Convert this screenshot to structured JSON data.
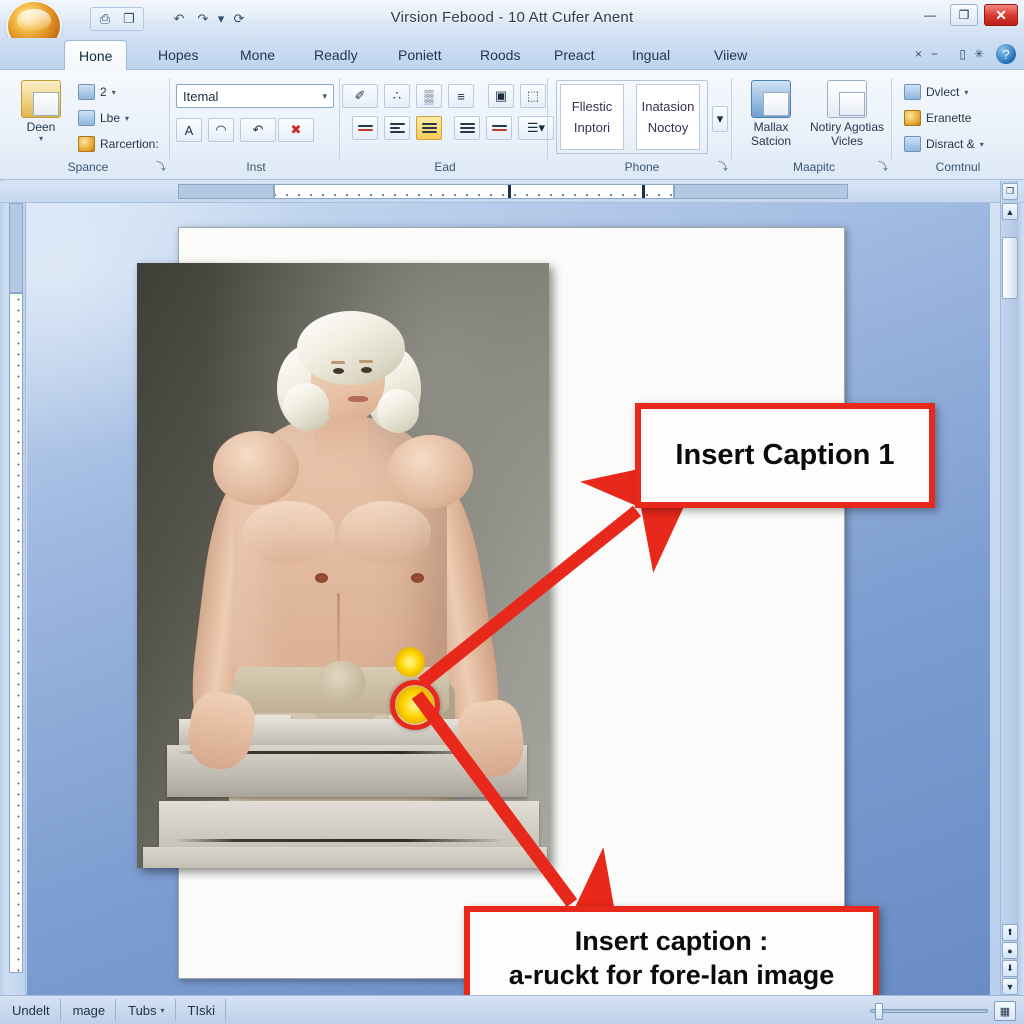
{
  "window": {
    "title": "Virsion Febood - 10 Att Cufer Anent",
    "minimize_label": "—",
    "restore_label": "❐",
    "close_label": "✕"
  },
  "quick_access": {
    "items": [
      {
        "name": "save-icon",
        "glyph": "⎙"
      },
      {
        "name": "new-document-icon",
        "glyph": "❐"
      },
      {
        "name": "undo-icon",
        "glyph": "↶"
      },
      {
        "name": "redo-icon",
        "glyph": "↷"
      },
      {
        "name": "customize-icon",
        "glyph": "▾"
      },
      {
        "name": "print-preview-icon",
        "glyph": "⟳"
      }
    ]
  },
  "tabs": [
    {
      "label": "Hone",
      "active": true
    },
    {
      "label": "Hopes",
      "active": false
    },
    {
      "label": "Mone",
      "active": false
    },
    {
      "label": "Readly",
      "active": false
    },
    {
      "label": "Poniett",
      "active": false
    },
    {
      "label": "Roods",
      "active": false
    },
    {
      "label": "Preact",
      "active": false
    },
    {
      "label": "Ingual",
      "active": false
    },
    {
      "label": "Viiew",
      "active": false
    }
  ],
  "ribbon_controls": {
    "close_label": "×",
    "minimize_label": "−",
    "doc_label": "▯",
    "star_label": "✳",
    "help_label": "?"
  },
  "ribbon": {
    "groups": [
      {
        "name": "Spance",
        "big_button": "Deen",
        "small_items": [
          {
            "label": "2",
            "icon": "paste-icon",
            "caret": true
          },
          {
            "label": "Lbe",
            "icon": "copy-icon",
            "caret": true
          },
          {
            "label": "Rarcertion:",
            "icon": "format-painter-icon",
            "caret": false
          }
        ],
        "dialog_launcher": "⤵"
      },
      {
        "name": "Inst",
        "font_value": "Itemal",
        "buttons_top": [
          {
            "name": "text-effects-icon",
            "glyph": "∴"
          },
          {
            "name": "shading-icon",
            "glyph": "▒"
          },
          {
            "name": "align-icon",
            "glyph": "≡"
          }
        ],
        "buttons_bottom": [
          {
            "name": "bold-icon",
            "glyph": "A"
          },
          {
            "name": "highlight-icon",
            "glyph": "◠"
          },
          {
            "name": "undo-format-icon",
            "glyph": "↶"
          },
          {
            "name": "clear-format-icon",
            "glyph": "✖",
            "caret": true
          },
          {
            "name": "font-color-icon",
            "glyph": "✐",
            "caret": true
          }
        ]
      },
      {
        "name": "Ead",
        "dialog_launcher": "⤵",
        "buttons_top": [
          {
            "name": "picture-border-icon",
            "glyph": "▣"
          },
          {
            "name": "crop-icon",
            "glyph": "⬚"
          },
          {
            "name": "position-icon",
            "glyph": "⬆",
            "caret": true
          }
        ]
      },
      {
        "name": "Phone",
        "style_boxes": [
          {
            "line1": "Fllestic",
            "line2": "Inptori"
          },
          {
            "line1": "Inatasion",
            "line2": "Noctoy"
          }
        ],
        "more_label": "▾",
        "dialog_launcher": "⤵"
      },
      {
        "name": "Maapitc",
        "big_buttons": [
          {
            "line1": "Mallax",
            "line2": "Satcion",
            "icon": "picture-tools-icon"
          },
          {
            "line1": "Notiry Agotias",
            "line2": "Vicles",
            "icon": "text-box-icon"
          }
        ],
        "dialog_launcher": "⤵"
      },
      {
        "name": "Comtnul",
        "small_items": [
          {
            "label": "Dvlect",
            "icon": "select-icon",
            "caret": true
          },
          {
            "label": "Eranette",
            "icon": "arrange-icon",
            "caret": false
          },
          {
            "label": "Disract &",
            "icon": "distribute-icon",
            "caret": true
          }
        ]
      }
    ]
  },
  "document": {
    "photo": {
      "alt_name": "statue-man-with-stone-slabs-photo",
      "highlight_color": "#e8281b",
      "burst_color": "#ffd400"
    },
    "callouts": [
      {
        "id": "callout-1",
        "text": "Insert Caption 1"
      },
      {
        "id": "callout-2",
        "text": "Insert caption :\na-ruckt for fore-lan image"
      }
    ]
  },
  "scrollbar": {
    "up_label": "▲",
    "down_label": "▼",
    "prev_label": "⬆",
    "select_label": "●",
    "next_label": "⬇",
    "top_icon_label": "❐"
  },
  "statusbar": {
    "items": [
      {
        "label": "Undelt",
        "caret": false
      },
      {
        "label": "mage",
        "caret": false
      },
      {
        "label": "Tubs",
        "caret": true
      },
      {
        "label": "TIski",
        "caret": false
      }
    ],
    "zoom_out_label": "−",
    "zoom_in_label": "+",
    "zoom_icon_label": "▦"
  }
}
